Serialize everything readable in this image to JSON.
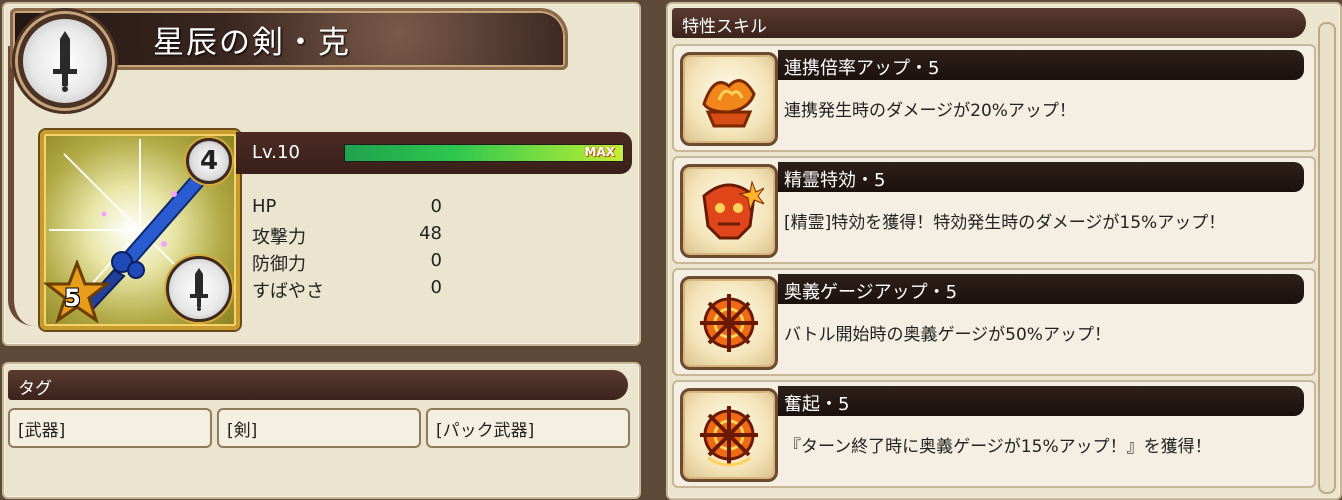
{
  "item": {
    "name": "星辰の剣・克",
    "level_label": "Lv.10",
    "gauge_label": "MAX",
    "gauge_fill": 1.0,
    "rank": "4",
    "rarity": "5"
  },
  "stats": [
    {
      "label": "HP",
      "value": "0"
    },
    {
      "label": "攻撃力",
      "value": "48"
    },
    {
      "label": "防御力",
      "value": "0"
    },
    {
      "label": "すばやさ",
      "value": "0"
    }
  ],
  "tags": {
    "header": "タグ",
    "items": [
      "[武器]",
      "[剣]",
      "[パック武器]"
    ]
  },
  "skills": {
    "header": "特性スキル",
    "items": [
      {
        "name": "連携倍率アップ・5",
        "desc": "連携発生時のダメージが20%アップ！",
        "icon": "chain-flame-icon"
      },
      {
        "name": "精霊特効・5",
        "desc": "[精霊]特効を獲得！特効発生時のダメージが15%アップ！",
        "icon": "spirit-skull-icon"
      },
      {
        "name": "奥義ゲージアップ・5",
        "desc": "バトル開始時の奥義ゲージが50%アップ！",
        "icon": "ougi-gauge-icon"
      },
      {
        "name": "奮起・5",
        "desc": "『ターン終了時に奥義ゲージが15%アップ！』を獲得！",
        "icon": "rally-gauge-icon"
      }
    ]
  },
  "colors": {
    "accent": "#3b231c",
    "gauge_start": "#1fa24e",
    "gauge_end": "#c7ee3a"
  }
}
